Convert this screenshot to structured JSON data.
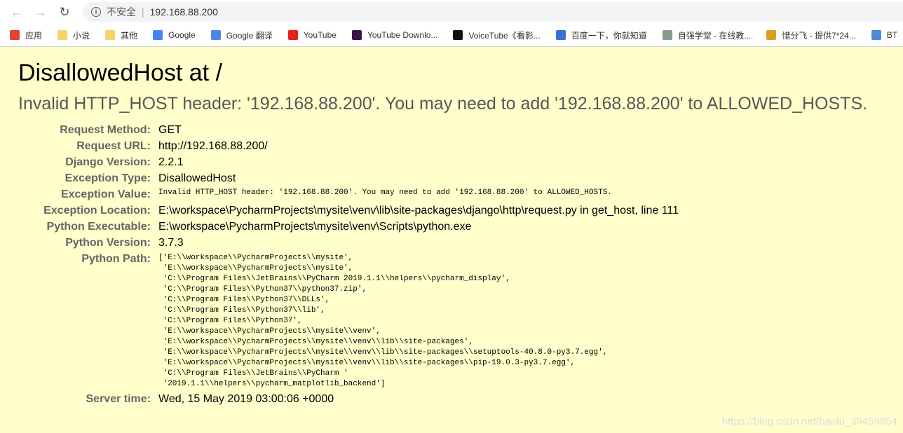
{
  "browser": {
    "security_label": "不安全",
    "url": "192.168.88.200"
  },
  "bookmarks": [
    {
      "label": "应用",
      "icon": "apps-grid-icon",
      "color": "#e34133"
    },
    {
      "label": "小说",
      "icon": "folder-icon",
      "color": "#f5d36b"
    },
    {
      "label": "其他",
      "icon": "folder-icon",
      "color": "#f5d36b"
    },
    {
      "label": "Google",
      "icon": "google-icon",
      "color": "#4285f4"
    },
    {
      "label": "Google 翻译",
      "icon": "google-translate-icon",
      "color": "#4a86e8"
    },
    {
      "label": "YouTube",
      "icon": "youtube-icon",
      "color": "#e62117"
    },
    {
      "label": "YouTube Downlo...",
      "icon": "q-icon",
      "color": "#3a1446"
    },
    {
      "label": "VoiceTube《看影...",
      "icon": "voicetube-icon",
      "color": "#111111"
    },
    {
      "label": "百度一下，你就知道",
      "icon": "baidu-paw-icon",
      "color": "#3b6fd6"
    },
    {
      "label": "自强学堂 - 在线教...",
      "icon": "site-icon",
      "color": "#8a9a8a"
    },
    {
      "label": "惜分飞 - 提供7*24...",
      "icon": "site-icon",
      "color": "#d9a020"
    },
    {
      "label": "BT",
      "icon": "bt-url-icon",
      "color": "#4a8ad8"
    }
  ],
  "page": {
    "title": "DisallowedHost at /",
    "subtitle": "Invalid HTTP_HOST header: '192.168.88.200'. You may need to add '192.168.88.200' to ALLOWED_HOSTS.",
    "rows": [
      {
        "label": "Request Method:",
        "value": "GET"
      },
      {
        "label": "Request URL:",
        "value": "http://192.168.88.200/"
      },
      {
        "label": "Django Version:",
        "value": "2.2.1"
      },
      {
        "label": "Exception Type:",
        "value": "DisallowedHost"
      },
      {
        "label": "Exception Value:",
        "value": "Invalid HTTP_HOST header: '192.168.88.200'. You may need to add '192.168.88.200' to ALLOWED_HOSTS.",
        "mono": true
      },
      {
        "label": "Exception Location:",
        "value": "E:\\workspace\\PycharmProjects\\mysite\\venv\\lib\\site-packages\\django\\http\\request.py in get_host, line 111"
      },
      {
        "label": "Python Executable:",
        "value": "E:\\workspace\\PycharmProjects\\mysite\\venv\\Scripts\\python.exe"
      },
      {
        "label": "Python Version:",
        "value": "3.7.3"
      }
    ],
    "python_path_label": "Python Path:",
    "python_path": [
      "['E:\\\\workspace\\\\PycharmProjects\\\\mysite',",
      " 'E:\\\\workspace\\\\PycharmProjects\\\\mysite',",
      " 'C:\\\\Program Files\\\\JetBrains\\\\PyCharm 2019.1.1\\\\helpers\\\\pycharm_display',",
      " 'C:\\\\Program Files\\\\Python37\\\\python37.zip',",
      " 'C:\\\\Program Files\\\\Python37\\\\DLLs',",
      " 'C:\\\\Program Files\\\\Python37\\\\lib',",
      " 'C:\\\\Program Files\\\\Python37',",
      " 'E:\\\\workspace\\\\PycharmProjects\\\\mysite\\\\venv',",
      " 'E:\\\\workspace\\\\PycharmProjects\\\\mysite\\\\venv\\\\lib\\\\site-packages',",
      " 'E:\\\\workspace\\\\PycharmProjects\\\\mysite\\\\venv\\\\lib\\\\site-packages\\\\setuptools-40.8.0-py3.7.egg',",
      " 'E:\\\\workspace\\\\PycharmProjects\\\\mysite\\\\venv\\\\lib\\\\site-packages\\\\pip-19.0.3-py3.7.egg',",
      " 'C:\\\\Program Files\\\\JetBrains\\\\PyCharm '",
      " '2019.1.1\\\\helpers\\\\pycharm_matplotlib_backend']"
    ],
    "server_time_label": "Server time:",
    "server_time": "Wed, 15 May 2019 03:00:06 +0000"
  },
  "watermark": "https://blog.csdn.net/baidu_39459954"
}
